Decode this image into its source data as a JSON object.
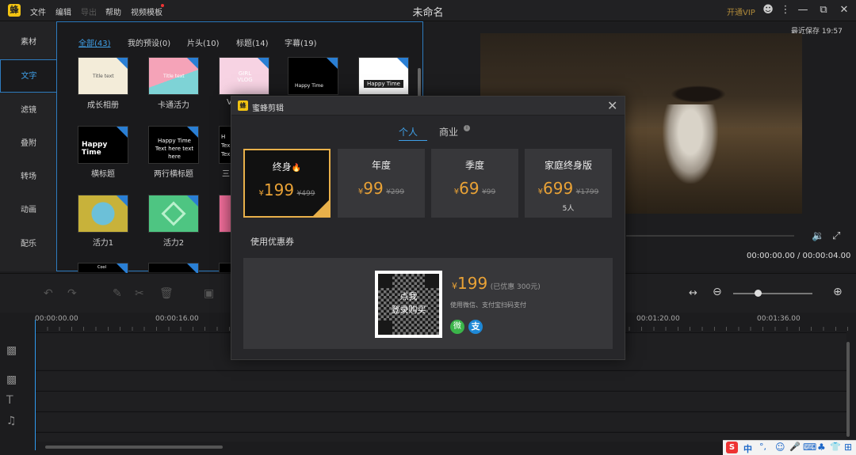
{
  "titlebar": {
    "logo_glyph": "蜂",
    "menus": [
      "文件",
      "编辑",
      "导出",
      "帮助",
      "视频模板"
    ],
    "title": "未命名",
    "vip": "开通VIP"
  },
  "sidebar": {
    "items": [
      "素材",
      "文字",
      "滤镜",
      "叠附",
      "转场",
      "动画",
      "配乐"
    ],
    "active_index": 1
  },
  "panel": {
    "filters": [
      "全部(43)",
      "我的预设(0)",
      "片头(10)",
      "标题(14)",
      "字幕(19)"
    ],
    "thumbs_row1": [
      {
        "label": "成长相册",
        "text": "Title text"
      },
      {
        "label": "卡通活力",
        "text": "Title text"
      },
      {
        "label": "V",
        "text": "GIRL VLOG"
      },
      {
        "label": "",
        "text": "Happy Time"
      },
      {
        "label": "",
        "text": "Happy Time"
      }
    ],
    "thumbs_row2": [
      {
        "label": "横标题",
        "text": "Happy Time"
      },
      {
        "label": "两行横标题",
        "text": "Happy Time Text here text here"
      },
      {
        "label": "三",
        "text": "H Tex Tex"
      }
    ],
    "thumbs_row3": [
      {
        "label": "活力1",
        "text": ""
      },
      {
        "label": "活力2",
        "text": ""
      },
      {
        "label": "",
        "text": ""
      }
    ],
    "thumbs_row4_text": "Cool"
  },
  "preview": {
    "saved": "最近保存 19:57",
    "timecode": "00:00:00.00 / 00:00:04.00"
  },
  "timeline": {
    "ruler": [
      "00:00:00.00",
      "00:00:16.00",
      "00:01:20.00",
      "00:01:36.00"
    ]
  },
  "dialog": {
    "logo_glyph": "蜂",
    "title": "蜜蜂剪辑",
    "close": "✕",
    "tabs": [
      "个人",
      "商业"
    ],
    "plans": [
      {
        "name": "终身",
        "yen": "¥",
        "price": "199",
        "old": "¥499",
        "extra": ""
      },
      {
        "name": "年度",
        "yen": "¥",
        "price": "99",
        "old": "¥299",
        "extra": ""
      },
      {
        "name": "季度",
        "yen": "¥",
        "price": "69",
        "old": "¥99",
        "extra": ""
      },
      {
        "name": "家庭终身版",
        "yen": "¥",
        "price": "699",
        "old": "¥1799",
        "extra": "5人"
      }
    ],
    "coupon": "使用优惠券",
    "qr_overlay_line1": "点我",
    "qr_overlay_line2": "登录购买",
    "pay_yen": "¥",
    "pay_price": "199",
    "pay_discount": "(已优惠 300元)",
    "pay_hint": "使用微信、支付宝扫码支付",
    "wechat_glyph": "微",
    "alipay_glyph": "支"
  },
  "ime": {
    "items": [
      "S",
      "中",
      "°,",
      "☺",
      "🎤",
      "⌨",
      "♣",
      "👕",
      "⊞"
    ]
  },
  "colors": {
    "accent": "#3fa0e8",
    "price": "#e9a236",
    "selected_border": "#e8b04a",
    "logo": "#f2c312"
  }
}
